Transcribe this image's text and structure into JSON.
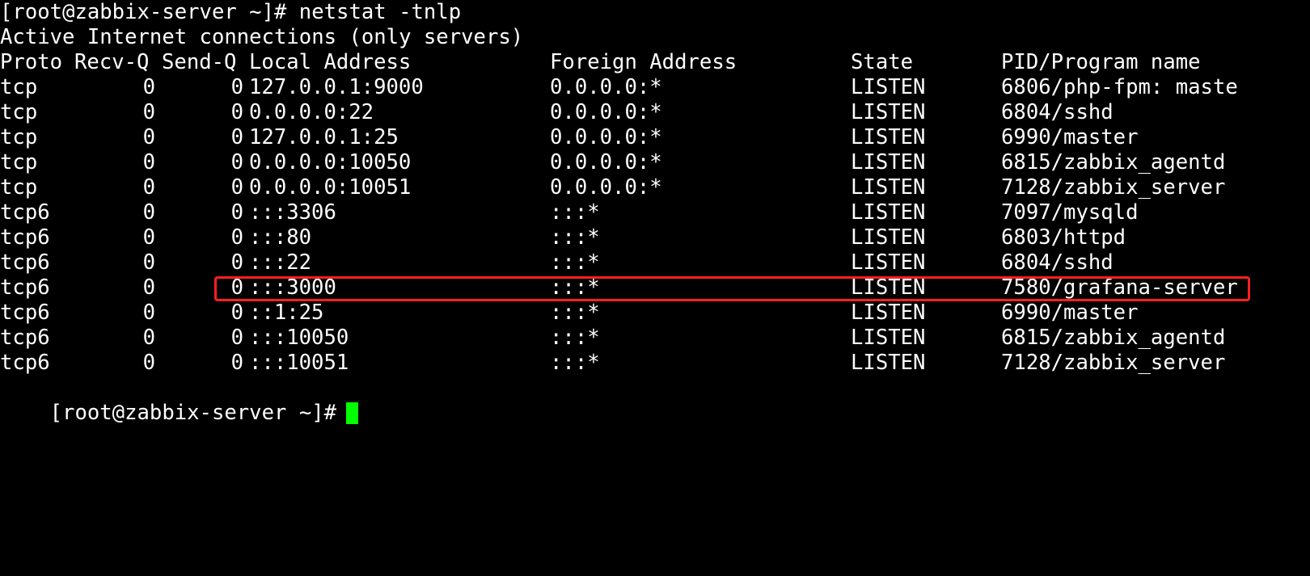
{
  "terminal": {
    "command_prompt": "[root@zabbix-server ~]# netstat -tnlp",
    "info_line": "Active Internet connections (only servers)",
    "headers": {
      "proto": "Proto",
      "recvq": "Recv-Q",
      "sendq": "Send-Q",
      "local": "Local Address",
      "foreign": "Foreign Address",
      "state": "State",
      "pid": "PID/Program name"
    },
    "rows": [
      {
        "proto": "tcp",
        "recvq": "0",
        "sendq": "0",
        "local": "127.0.0.1:9000",
        "foreign": "0.0.0.0:*",
        "state": "LISTEN",
        "pid": "6806/php-fpm: maste"
      },
      {
        "proto": "tcp",
        "recvq": "0",
        "sendq": "0",
        "local": "0.0.0.0:22",
        "foreign": "0.0.0.0:*",
        "state": "LISTEN",
        "pid": "6804/sshd"
      },
      {
        "proto": "tcp",
        "recvq": "0",
        "sendq": "0",
        "local": "127.0.0.1:25",
        "foreign": "0.0.0.0:*",
        "state": "LISTEN",
        "pid": "6990/master"
      },
      {
        "proto": "tcp",
        "recvq": "0",
        "sendq": "0",
        "local": "0.0.0.0:10050",
        "foreign": "0.0.0.0:*",
        "state": "LISTEN",
        "pid": "6815/zabbix_agentd"
      },
      {
        "proto": "tcp",
        "recvq": "0",
        "sendq": "0",
        "local": "0.0.0.0:10051",
        "foreign": "0.0.0.0:*",
        "state": "LISTEN",
        "pid": "7128/zabbix_server"
      },
      {
        "proto": "tcp6",
        "recvq": "0",
        "sendq": "0",
        "local": ":::3306",
        "foreign": ":::*",
        "state": "LISTEN",
        "pid": "7097/mysqld"
      },
      {
        "proto": "tcp6",
        "recvq": "0",
        "sendq": "0",
        "local": ":::80",
        "foreign": ":::*",
        "state": "LISTEN",
        "pid": "6803/httpd"
      },
      {
        "proto": "tcp6",
        "recvq": "0",
        "sendq": "0",
        "local": ":::22",
        "foreign": ":::*",
        "state": "LISTEN",
        "pid": "6804/sshd"
      },
      {
        "proto": "tcp6",
        "recvq": "0",
        "sendq": "0",
        "local": ":::3000",
        "foreign": ":::*",
        "state": "LISTEN",
        "pid": "7580/grafana-server"
      },
      {
        "proto": "tcp6",
        "recvq": "0",
        "sendq": "0",
        "local": "::1:25",
        "foreign": ":::*",
        "state": "LISTEN",
        "pid": "6990/master"
      },
      {
        "proto": "tcp6",
        "recvq": "0",
        "sendq": "0",
        "local": ":::10050",
        "foreign": ":::*",
        "state": "LISTEN",
        "pid": "6815/zabbix_agentd"
      },
      {
        "proto": "tcp6",
        "recvq": "0",
        "sendq": "0",
        "local": ":::10051",
        "foreign": ":::*",
        "state": "LISTEN",
        "pid": "7128/zabbix_server"
      }
    ],
    "final_prompt": "[root@zabbix-server ~]#",
    "colors": {
      "background": "#000000",
      "foreground": "#ffffff",
      "cursor": "#00ff00",
      "highlight_border": "#ff2020"
    }
  }
}
